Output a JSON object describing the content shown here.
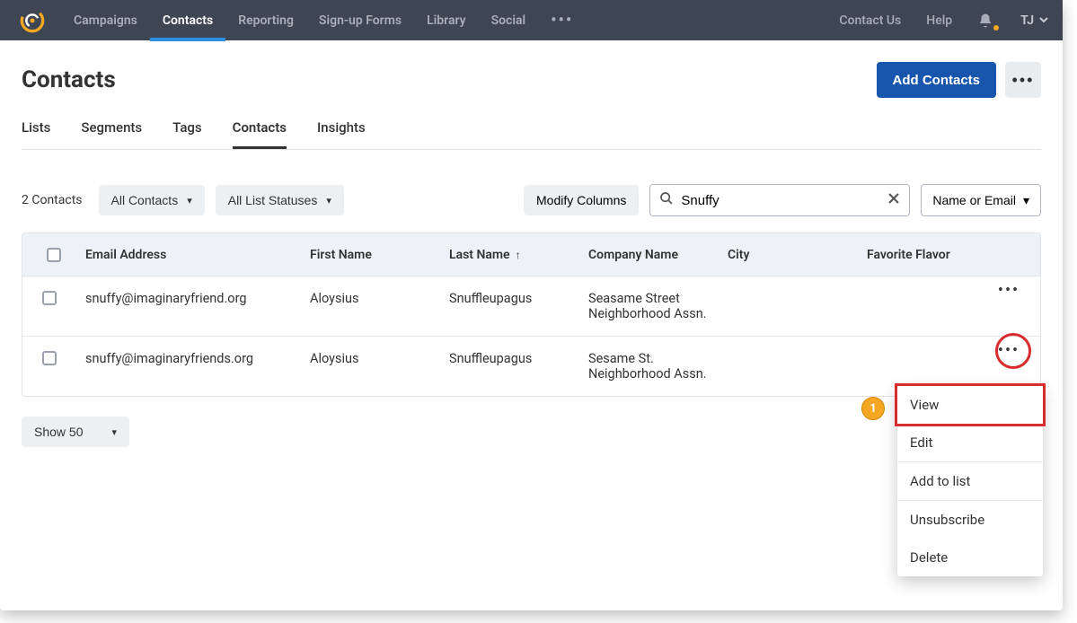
{
  "topnav": {
    "items": [
      "Campaigns",
      "Contacts",
      "Reporting",
      "Sign-up Forms",
      "Library",
      "Social"
    ],
    "active_index": 1,
    "right": {
      "contact_us": "Contact Us",
      "help": "Help",
      "user_initials": "TJ"
    }
  },
  "page": {
    "title": "Contacts",
    "add_button": "Add Contacts"
  },
  "subtabs": {
    "items": [
      "Lists",
      "Segments",
      "Tags",
      "Contacts",
      "Insights"
    ],
    "active_index": 3
  },
  "toolbar": {
    "count_label": "2 Contacts",
    "filter_all_contacts": "All Contacts",
    "filter_all_statuses": "All List Statuses",
    "modify_columns": "Modify Columns",
    "search_value": "Snuffy",
    "search_scope": "Name or Email"
  },
  "table": {
    "headers": {
      "email": "Email Address",
      "first_name": "First Name",
      "last_name": "Last Name",
      "company": "Company Name",
      "city": "City",
      "flavor": "Favorite Flavor"
    },
    "rows": [
      {
        "email": "snuffy@imaginaryfriend.org",
        "first_name": "Aloysius",
        "last_name": "Snuffleupagus",
        "company": "Seasame Street Neighborhood Assn.",
        "city": "",
        "flavor": ""
      },
      {
        "email": "snuffy@imaginaryfriends.org",
        "first_name": "Aloysius",
        "last_name": "Snuffleupagus",
        "company": "Sesame St. Neighborhood Assn.",
        "city": "",
        "flavor": ""
      }
    ]
  },
  "row_menu": {
    "items": [
      "View",
      "Edit",
      "Add to list",
      "Unsubscribe",
      "Delete"
    ],
    "highlighted_index": 0
  },
  "pager": {
    "label": "Show 50"
  },
  "annotation": {
    "badge_1": "1"
  }
}
